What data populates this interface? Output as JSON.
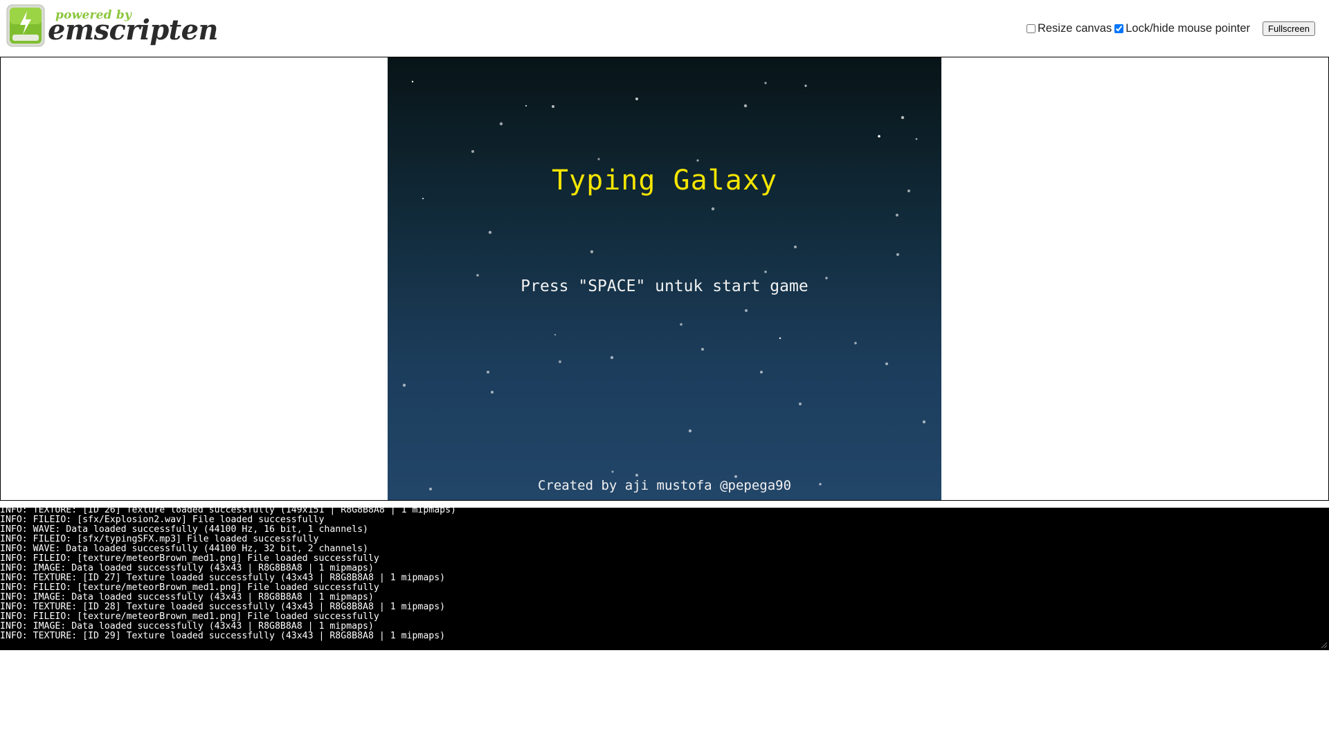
{
  "header": {
    "logo_powered": "powered by",
    "logo_name": "emscripten",
    "logo_accent_color": "#8cc63f",
    "resize_canvas": {
      "label": "Resize canvas",
      "checked": false
    },
    "lock_pointer": {
      "label": "Lock/hide mouse pointer",
      "checked": true
    },
    "fullscreen_label": "Fullscreen"
  },
  "game": {
    "title": "Typing Galaxy",
    "title_color": "#f5e500",
    "prompt": "Press \"SPACE\" untuk start game",
    "credit": "Created by aji mustofa @pepega90"
  },
  "console": {
    "lines": [
      "INFO: TEXTURE: [ID 26] Texture loaded successfully (149x151 | R8G8B8A8 | 1 mipmaps)",
      "INFO: FILEIO: [sfx/Explosion2.wav] File loaded successfully",
      "INFO: WAVE: Data loaded successfully (44100 Hz, 16 bit, 1 channels)",
      "INFO: FILEIO: [sfx/typingSFX.mp3] File loaded successfully",
      "INFO: WAVE: Data loaded successfully (44100 Hz, 32 bit, 2 channels)",
      "INFO: FILEIO: [texture/meteorBrown_med1.png] File loaded successfully",
      "INFO: IMAGE: Data loaded successfully (43x43 | R8G8B8A8 | 1 mipmaps)",
      "INFO: TEXTURE: [ID 27] Texture loaded successfully (43x43 | R8G8B8A8 | 1 mipmaps)",
      "INFO: FILEIO: [texture/meteorBrown_med1.png] File loaded successfully",
      "INFO: IMAGE: Data loaded successfully (43x43 | R8G8B8A8 | 1 mipmaps)",
      "INFO: TEXTURE: [ID 28] Texture loaded successfully (43x43 | R8G8B8A8 | 1 mipmaps)",
      "INFO: FILEIO: [texture/meteorBrown_med1.png] File loaded successfully",
      "INFO: IMAGE: Data loaded successfully (43x43 | R8G8B8A8 | 1 mipmaps)",
      "INFO: TEXTURE: [ID 29] Texture loaded successfully (43x43 | R8G8B8A8 | 1 mipmaps)"
    ]
  }
}
